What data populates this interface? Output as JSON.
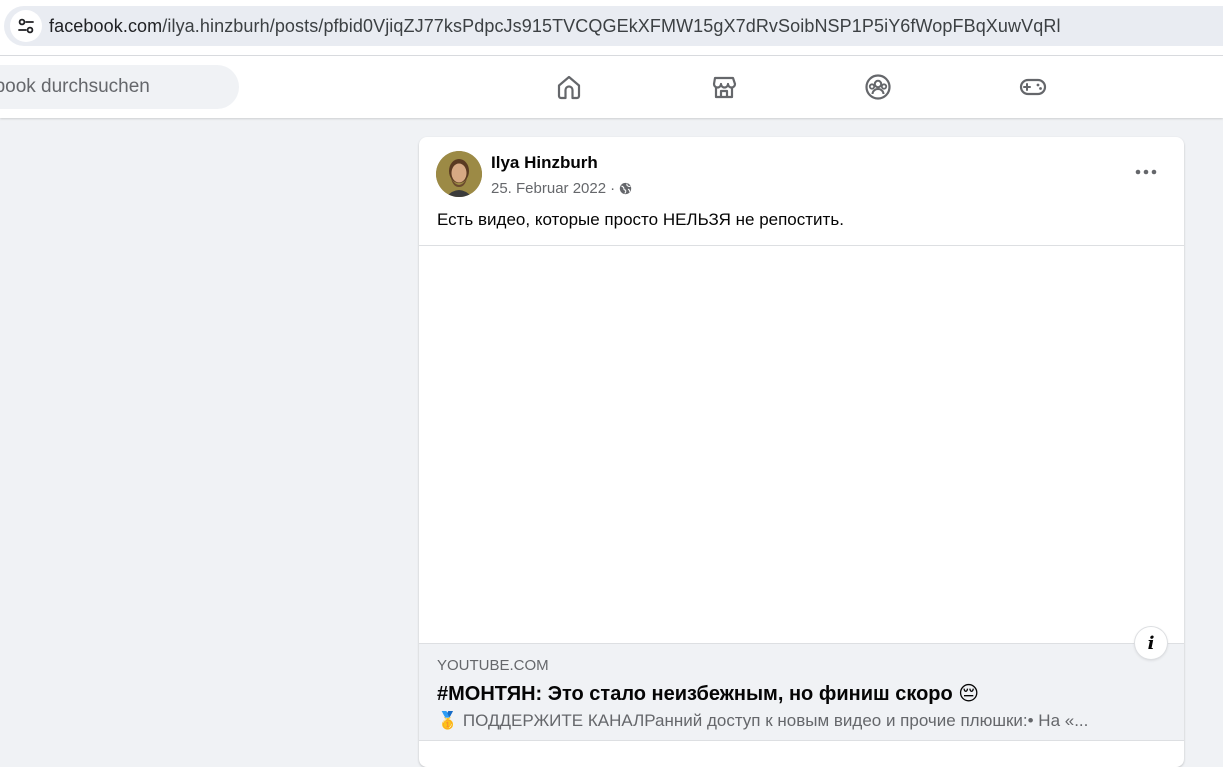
{
  "browser": {
    "url_host": "facebook.com",
    "url_path": "/ilya.hinzburh/posts/pfbid0VjiqZJ77ksPdpcJs915TVCQGEkXFMW15gX7dRvSoibNSP1P5iY6fWopFBqXuwVqRl"
  },
  "nav": {
    "search_placeholder": "ebook durchsuchen",
    "icons": [
      "home-icon",
      "marketplace-icon",
      "groups-icon",
      "gaming-icon"
    ]
  },
  "post": {
    "author": "Ilya Hinzburh",
    "date": "25. Februar 2022",
    "separator": "·",
    "audience_icon": "globe-icon",
    "text": "Есть видео, которые просто НЕЛЬЗЯ не репостить.",
    "link": {
      "domain": "YOUTUBE.COM",
      "title": "#МОНТЯН: Это стало неизбежным, но финиш скоро 😔",
      "description": "🥇 ПОДДЕРЖИТЕ КАНАЛРанний доступ к новым видео и прочие плюшки:• На «..."
    },
    "info_label": "i"
  },
  "colors": {
    "page_bg": "#f0f2f5",
    "card_bg": "#ffffff",
    "text_primary": "#050505",
    "text_secondary": "#65676b"
  }
}
